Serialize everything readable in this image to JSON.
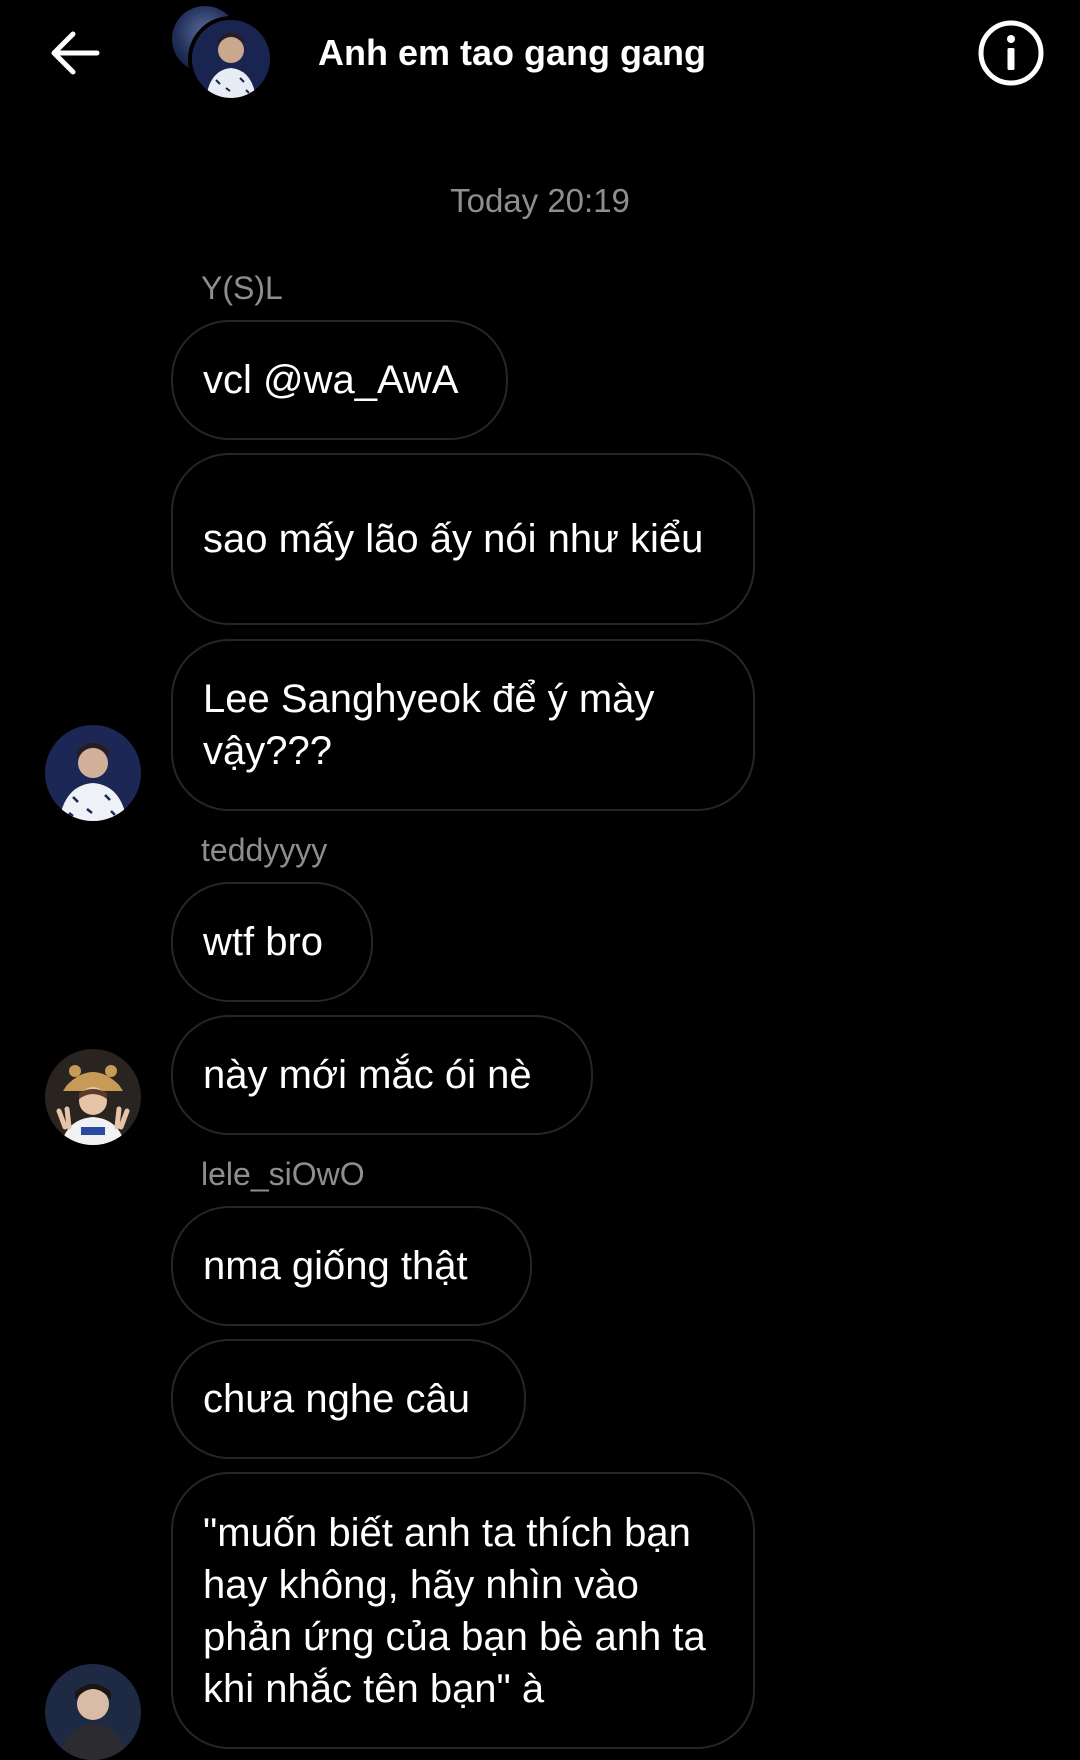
{
  "header": {
    "title": "Anh em tao gang gang",
    "back_icon": "arrow-left-icon",
    "info_icon": "info-circle-icon"
  },
  "timestamp": "Today 20:19",
  "groups": [
    {
      "sender": "Y(S)L",
      "messages": [
        "vcl @wa_AwA",
        "sao mấy lão ấy nói như kiểu",
        "Lee Sanghyeok để ý mày vậy???"
      ]
    },
    {
      "sender": "teddyyyy",
      "messages": [
        "wtf bro",
        "này mới mắc ói nè"
      ]
    },
    {
      "sender": "lele_siOwO",
      "messages": [
        "nma giống thật",
        "chưa nghe câu",
        "\"muốn biết anh ta thích bạn hay không, hãy nhìn vào phản ứng của bạn bè anh ta khi nhắc tên bạn\" à"
      ]
    }
  ],
  "colors": {
    "background": "#000000",
    "text": "#ffffff",
    "muted_text": "#8e8e8e",
    "bubble_border": "#262626"
  }
}
